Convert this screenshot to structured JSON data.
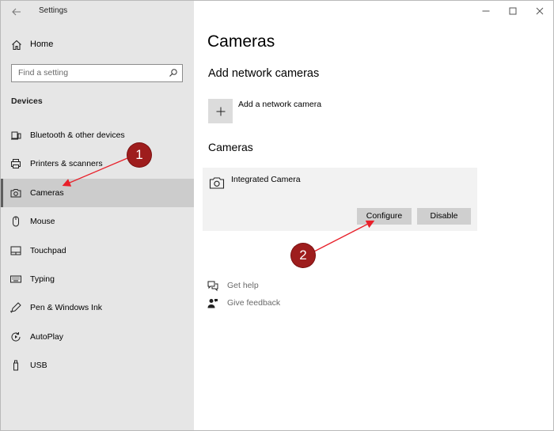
{
  "window": {
    "title": "Settings"
  },
  "sidebar": {
    "home_label": "Home",
    "search_placeholder": "Find a setting",
    "section_title": "Devices",
    "items": [
      {
        "label": "Bluetooth & other devices",
        "icon": "bluetooth-devices-icon",
        "selected": false
      },
      {
        "label": "Printers & scanners",
        "icon": "printer-icon",
        "selected": false
      },
      {
        "label": "Cameras",
        "icon": "camera-icon",
        "selected": true
      },
      {
        "label": "Mouse",
        "icon": "mouse-icon",
        "selected": false
      },
      {
        "label": "Touchpad",
        "icon": "touchpad-icon",
        "selected": false
      },
      {
        "label": "Typing",
        "icon": "keyboard-icon",
        "selected": false
      },
      {
        "label": "Pen & Windows Ink",
        "icon": "pen-icon",
        "selected": false
      },
      {
        "label": "AutoPlay",
        "icon": "autoplay-icon",
        "selected": false
      },
      {
        "label": "USB",
        "icon": "usb-icon",
        "selected": false
      }
    ]
  },
  "main": {
    "page_title": "Cameras",
    "add_section_title": "Add network cameras",
    "add_label": "Add a network camera",
    "cameras_title": "Cameras",
    "camera": {
      "name": "Integrated Camera",
      "configure_label": "Configure",
      "disable_label": "Disable"
    },
    "help": [
      {
        "label": "Get help",
        "icon": "help-chat-icon"
      },
      {
        "label": "Give feedback",
        "icon": "feedback-icon"
      }
    ]
  },
  "annotations": {
    "badge_1": "1",
    "badge_2": "2",
    "color": "#9e1d1d",
    "arrow_color": "#e8202a"
  }
}
